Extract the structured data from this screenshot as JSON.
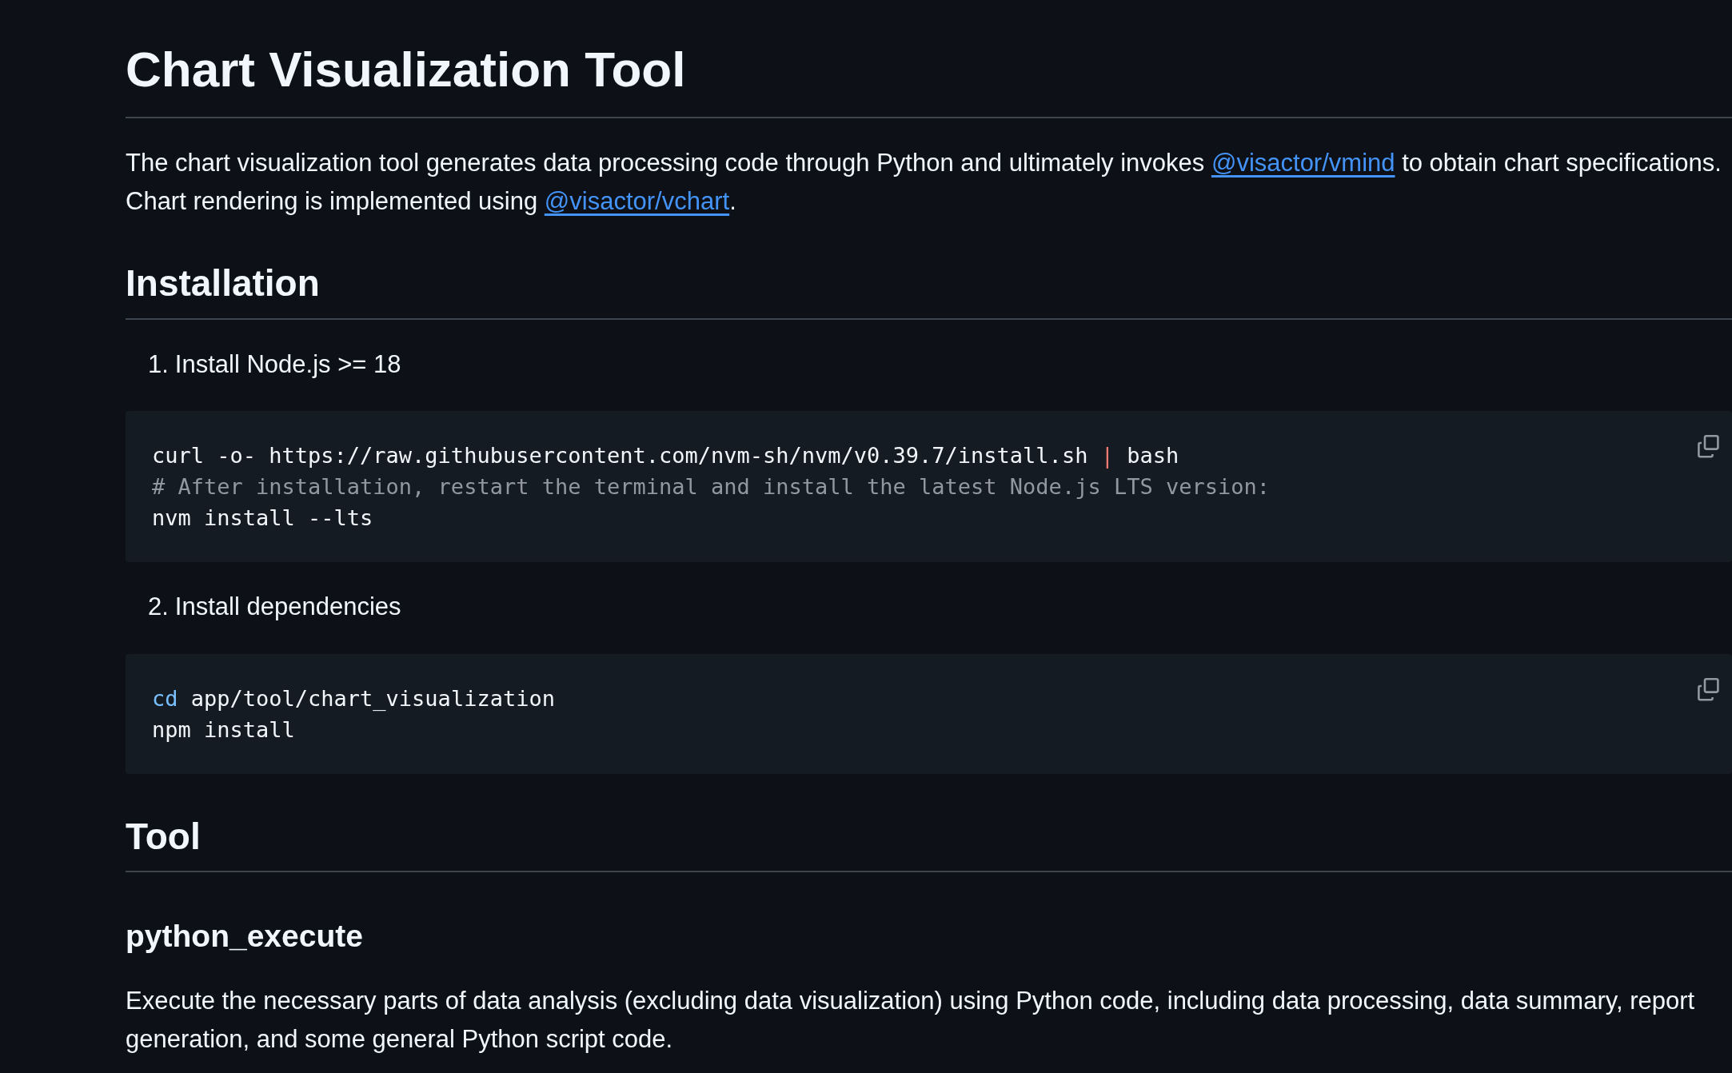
{
  "title": "Chart Visualization Tool",
  "intro": [
    {
      "kind": "text",
      "text": "The chart visualization tool generates data processing code through Python and ultimately invokes "
    },
    {
      "kind": "link",
      "text": "@visactor/vmind"
    },
    {
      "kind": "text",
      "text": " to obtain chart specifications. Chart rendering is implemented using "
    },
    {
      "kind": "link",
      "text": "@visactor/vchart"
    },
    {
      "kind": "text",
      "text": "."
    }
  ],
  "sections": [
    {
      "heading": "Installation",
      "kind": "h2",
      "blocks": [
        {
          "kind": "step",
          "number": "1.",
          "text": "Install Node.js >= 18"
        },
        {
          "kind": "code",
          "lines": [
            [
              {
                "kind": "plain",
                "text": "curl -o- https://raw.githubusercontent.com/nvm-sh/nvm/v0.39.7/install.sh "
              },
              {
                "kind": "operator",
                "text": "|"
              },
              {
                "kind": "plain",
                "text": " bash"
              }
            ],
            [
              {
                "kind": "comment",
                "text": "# After installation, restart the terminal and install the latest Node.js LTS version:"
              }
            ],
            [
              {
                "kind": "plain",
                "text": "nvm install --lts"
              }
            ]
          ]
        },
        {
          "kind": "step",
          "number": "2.",
          "text": "Install dependencies"
        },
        {
          "kind": "code",
          "lines": [
            [
              {
                "kind": "keyword",
                "text": "cd"
              },
              {
                "kind": "plain",
                "text": " app/tool/chart_visualization"
              }
            ],
            [
              {
                "kind": "plain",
                "text": "npm install"
              }
            ]
          ]
        }
      ]
    },
    {
      "heading": "Tool",
      "kind": "h2"
    },
    {
      "heading": "python_execute",
      "kind": "h3",
      "blocks": [
        {
          "kind": "paragraph",
          "text": "Execute the necessary parts of data analysis (excluding data visualization) using Python code, including data processing, data summary, report generation, and some general Python script code."
        }
      ]
    }
  ]
}
